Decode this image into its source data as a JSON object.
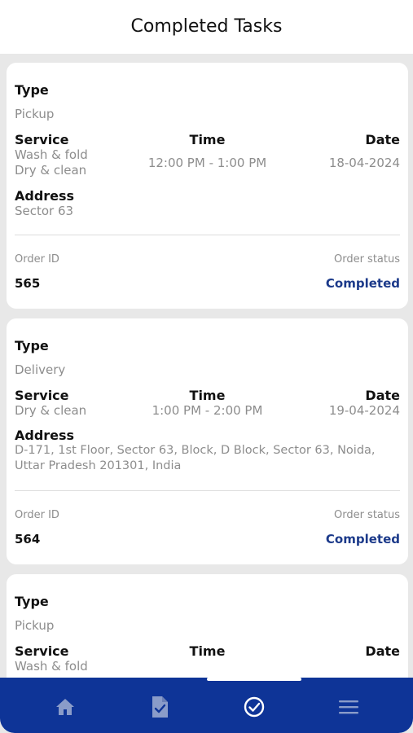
{
  "header": {
    "title": "Completed Tasks"
  },
  "labels": {
    "type": "Type",
    "service": "Service",
    "time": "Time",
    "date": "Date",
    "address": "Address",
    "order_id": "Order ID",
    "order_status": "Order status"
  },
  "tasks": [
    {
      "type": "Pickup",
      "services": [
        "Wash & fold",
        "Dry & clean"
      ],
      "time": "12:00 PM - 1:00 PM",
      "date": "18-04-2024",
      "address": "Sector 63",
      "order_id": "565",
      "status": "Completed"
    },
    {
      "type": "Delivery",
      "services": [
        "Dry & clean"
      ],
      "time": "1:00 PM - 2:00 PM",
      "date": "19-04-2024",
      "address_lines": [
        "D-171, 1st Floor, Sector 63, Block, D Block, Sector 63, Noida,",
        "Uttar Pradesh 201301, India"
      ],
      "order_id": "564",
      "status": "Completed"
    },
    {
      "type": "Pickup",
      "services": [
        "Wash & fold"
      ]
    }
  ],
  "nav": {
    "items": [
      {
        "icon": "home-icon"
      },
      {
        "icon": "document-check-icon"
      },
      {
        "icon": "check-circle-icon",
        "active": true
      },
      {
        "icon": "menu-icon"
      }
    ],
    "color_active": "#ffffff",
    "color_inactive": "#8a9cc9",
    "bar_color": "#0e3497"
  },
  "colors": {
    "accent": "#1c3a8a"
  }
}
